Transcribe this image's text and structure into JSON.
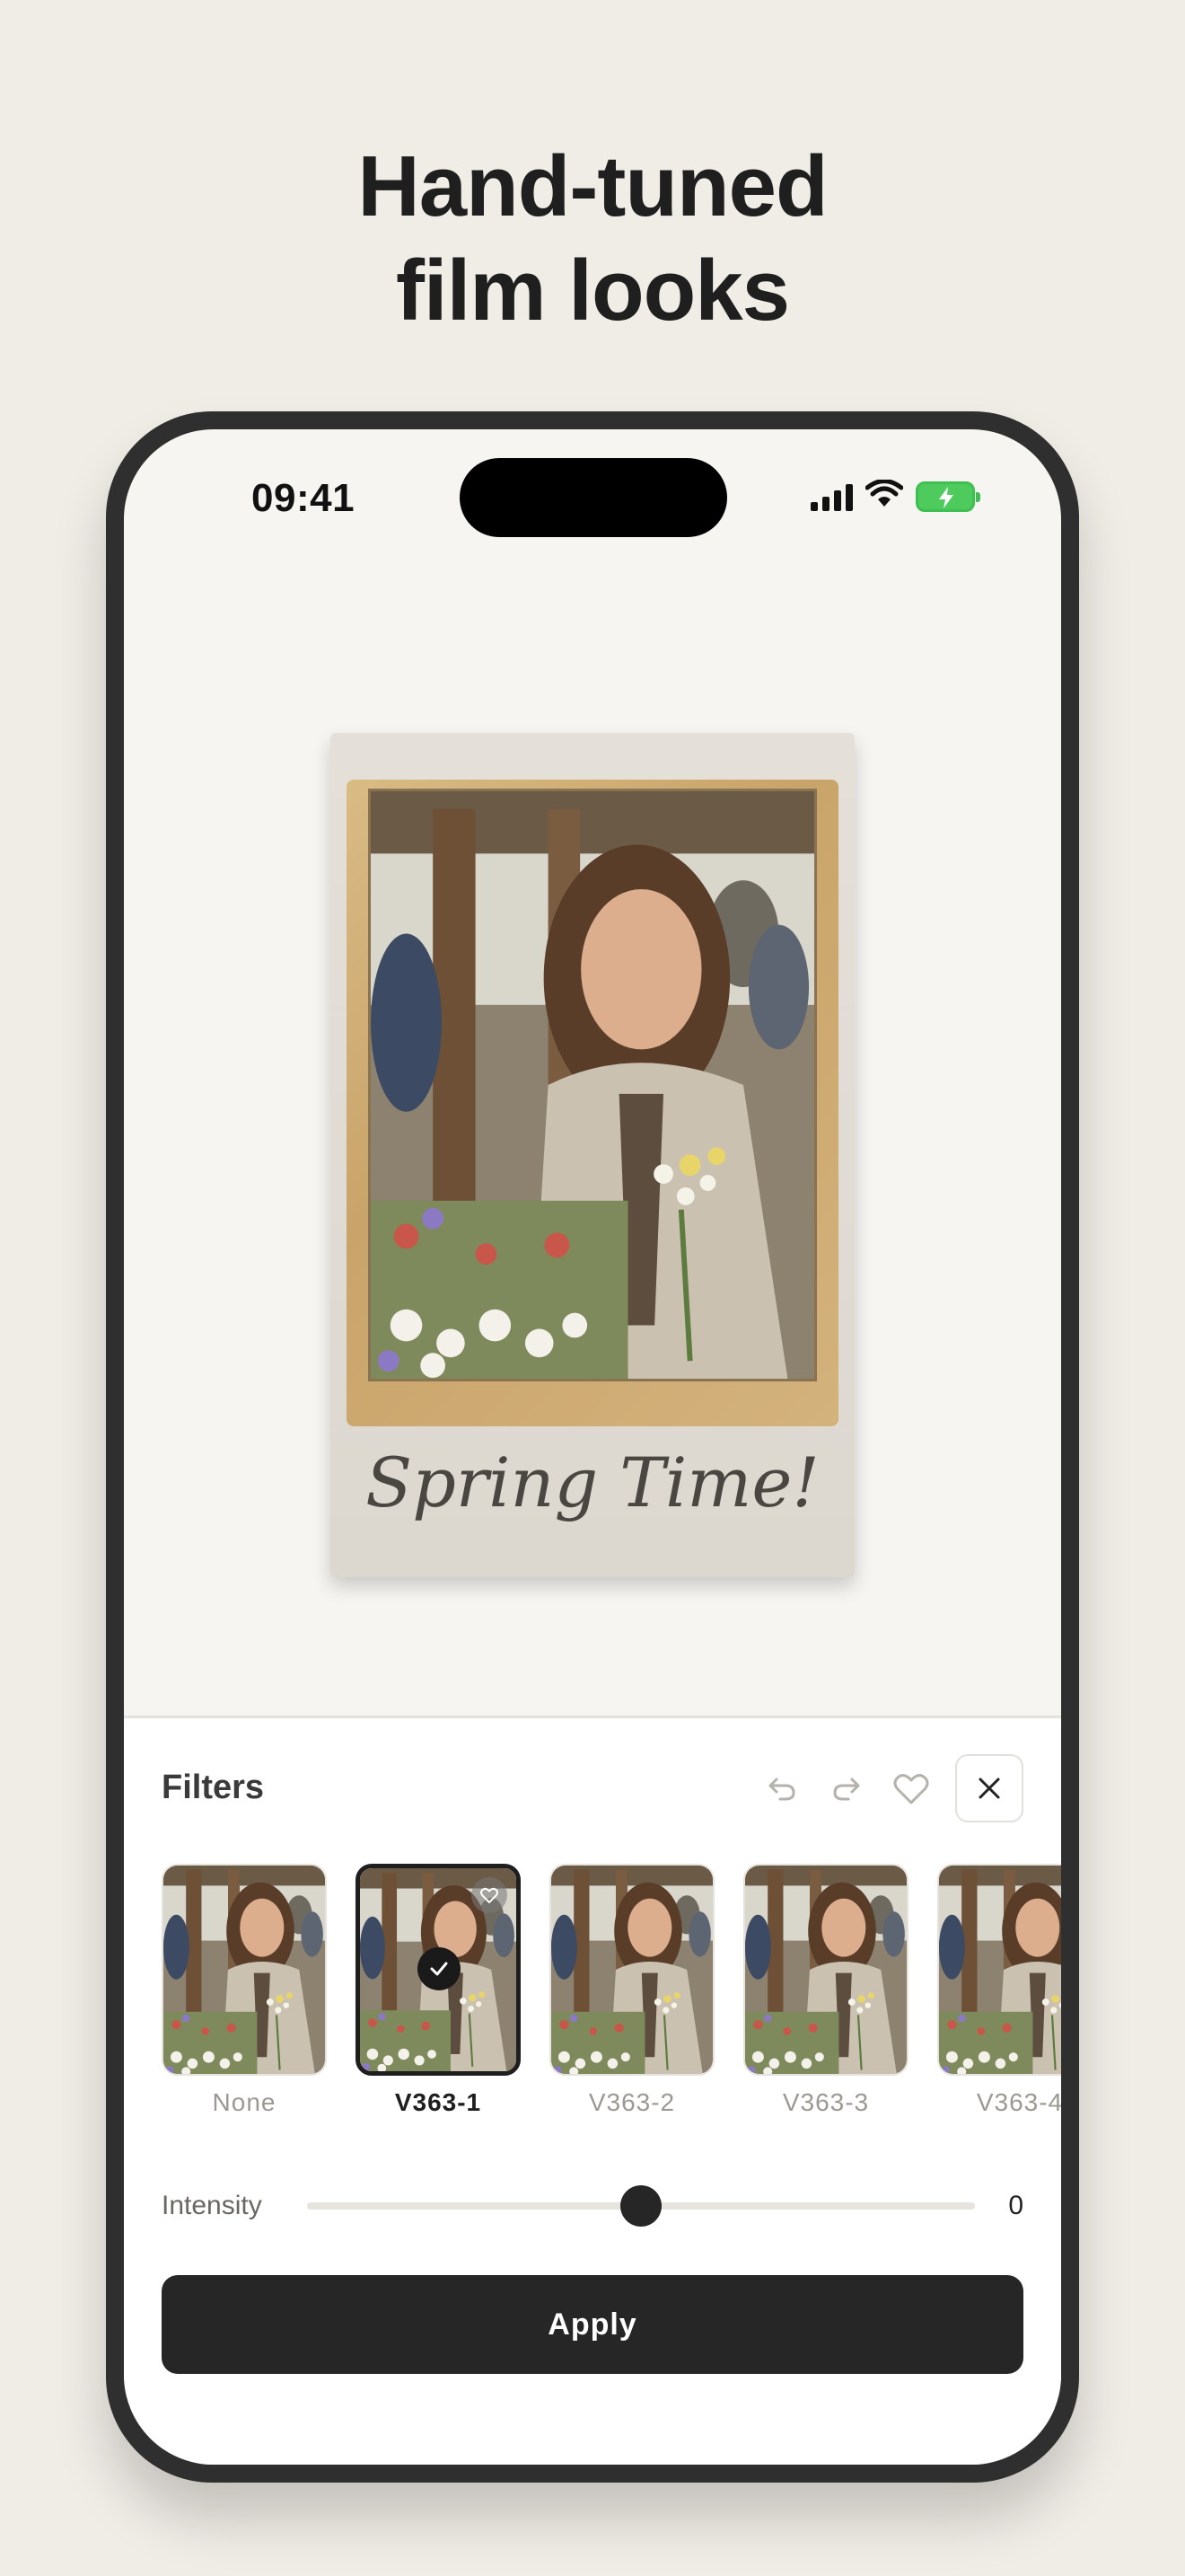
{
  "headline": {
    "line1": "Hand-tuned",
    "line2": "film looks"
  },
  "status_bar": {
    "time": "09:41",
    "icons": [
      "cellular-signal-icon",
      "wifi-icon",
      "battery-charging-icon"
    ]
  },
  "photo": {
    "caption": "Spring Time!"
  },
  "filters_panel": {
    "title": "Filters",
    "actions": [
      "undo-icon",
      "redo-icon",
      "heart-icon",
      "close-icon"
    ],
    "items": [
      {
        "label": "None",
        "selected": false
      },
      {
        "label": "V363-1",
        "selected": true
      },
      {
        "label": "V363-2",
        "selected": false
      },
      {
        "label": "V363-3",
        "selected": false
      },
      {
        "label": "V363-4",
        "selected": false
      }
    ],
    "intensity": {
      "label": "Intensity",
      "value": "0",
      "slider_position": 0.5
    },
    "apply_label": "Apply"
  },
  "colors": {
    "background": "#f0ece6",
    "phone_frame": "#2f2f2f",
    "button": "#262626"
  }
}
